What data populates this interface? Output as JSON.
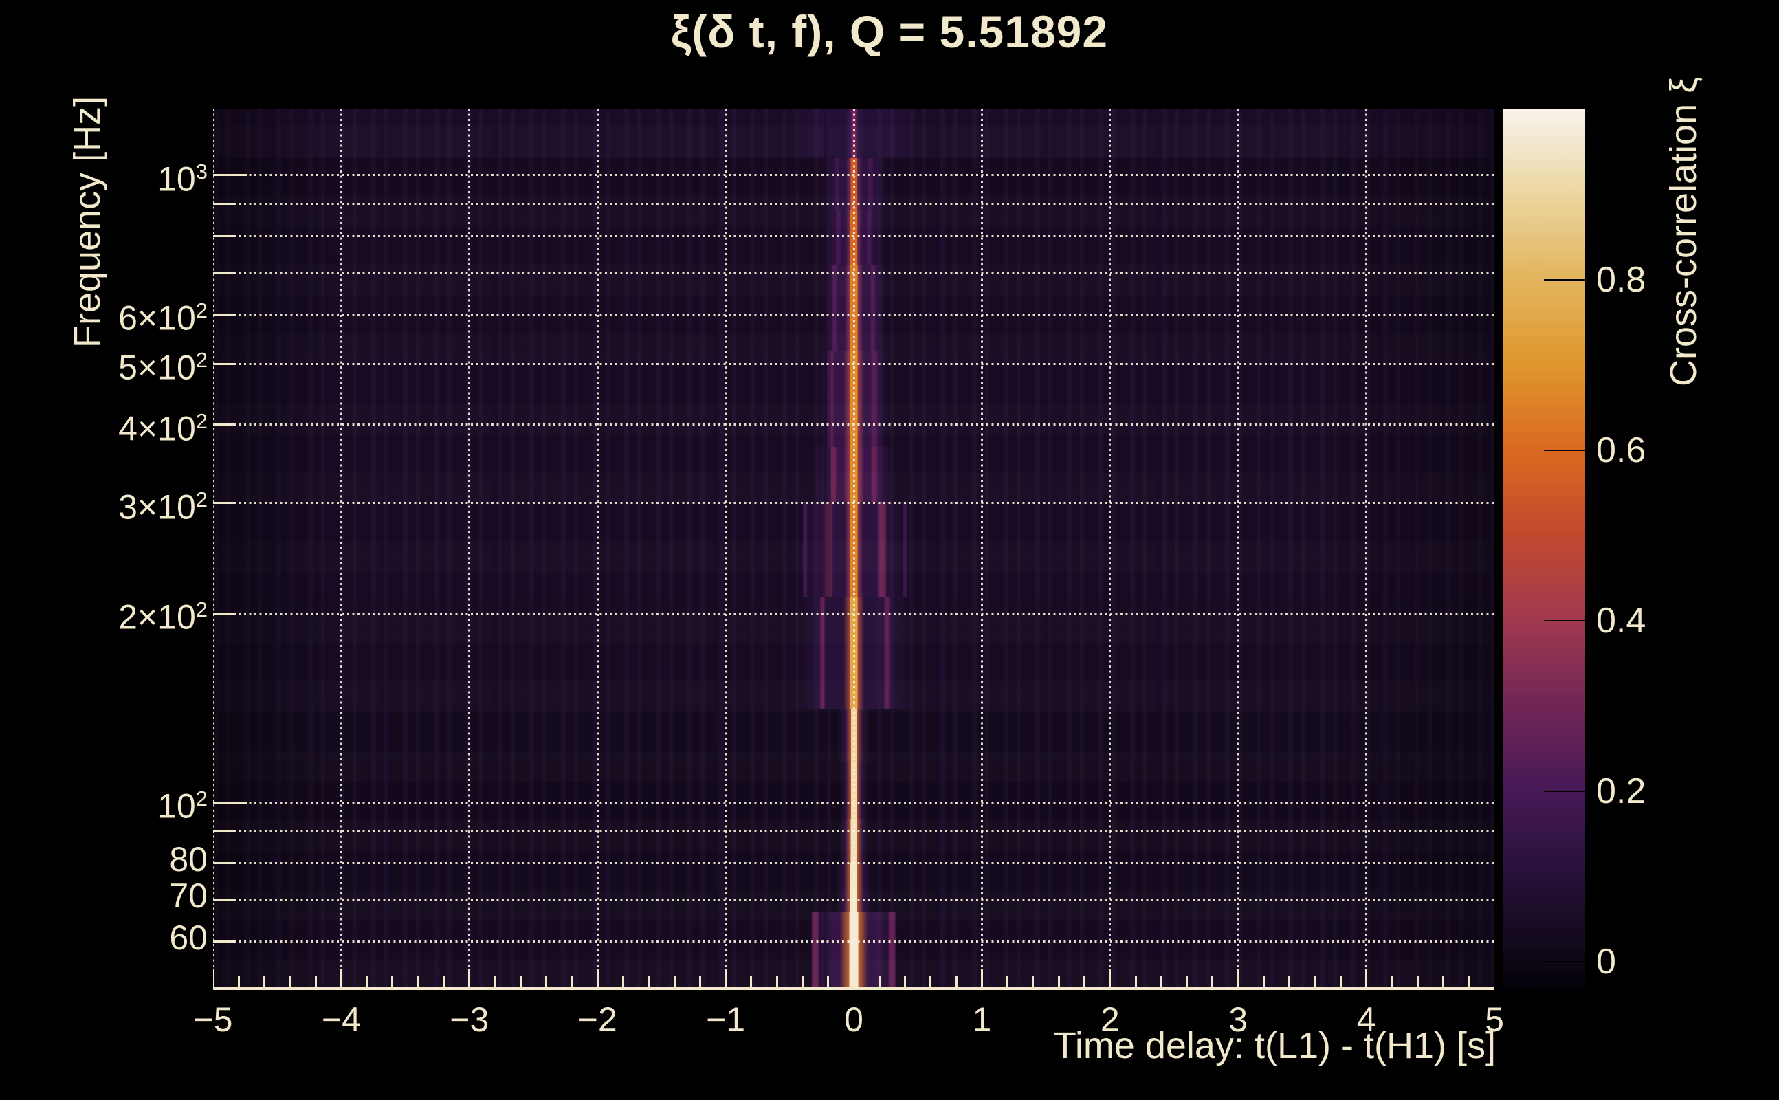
{
  "title": {
    "text": "ξ(δ t, f), Q = 5.51892"
  },
  "axes": {
    "x": {
      "title": "Time delay: t(L1) - t(H1) [s]",
      "ticks": [
        {
          "v": -5,
          "label": "−5"
        },
        {
          "v": -4,
          "label": "−4"
        },
        {
          "v": -3,
          "label": "−3"
        },
        {
          "v": -2,
          "label": "−2"
        },
        {
          "v": -1,
          "label": "−1"
        },
        {
          "v": 0,
          "label": "0"
        },
        {
          "v": 1,
          "label": "1"
        },
        {
          "v": 2,
          "label": "2"
        },
        {
          "v": 3,
          "label": "3"
        },
        {
          "v": 4,
          "label": "4"
        },
        {
          "v": 5,
          "label": "5"
        }
      ],
      "minor_step": 0.2
    },
    "y": {
      "title": "Frequency [Hz]",
      "ticks": [
        {
          "f": 1000,
          "mantissa": "10",
          "exp": "3"
        },
        {
          "f": 600,
          "mantissa": "6×10",
          "exp": "2"
        },
        {
          "f": 500,
          "mantissa": "5×10",
          "exp": "2"
        },
        {
          "f": 400,
          "mantissa": "4×10",
          "exp": "2"
        },
        {
          "f": 300,
          "mantissa": "3×10",
          "exp": "2"
        },
        {
          "f": 200,
          "mantissa": "2×10",
          "exp": "2"
        },
        {
          "f": 100,
          "mantissa": "10",
          "exp": "2"
        },
        {
          "f": 80,
          "mantissa": "80",
          "exp": null
        },
        {
          "f": 70,
          "mantissa": "70",
          "exp": null
        },
        {
          "f": 60,
          "mantissa": "60",
          "exp": null
        }
      ]
    },
    "colorbar": {
      "title": "Cross-correlation ξ",
      "ticks": [
        {
          "v": 0,
          "label": "0"
        },
        {
          "v": 0.2,
          "label": "0.2"
        },
        {
          "v": 0.4,
          "label": "0.4"
        },
        {
          "v": 0.6,
          "label": "0.6"
        },
        {
          "v": 0.8,
          "label": "0.8"
        }
      ]
    }
  },
  "chart_data": {
    "type": "heatmap",
    "title": "ξ(δ t, f), Q = 5.51892",
    "q_value": 5.51892,
    "xlabel": "Time delay: t(L1) - t(H1) [s]",
    "ylabel": "Frequency [Hz]",
    "zlabel": "Cross-correlation ξ",
    "x_range_s": [
      -5,
      5
    ],
    "y_range_hz": [
      50.2,
      1277
    ],
    "y_scale": "log",
    "z_range": [
      -0.033,
      1.001
    ],
    "grid": "dotted cream lines on",
    "grid_y_lines_hz": [
      60,
      70,
      80,
      90,
      100,
      200,
      300,
      400,
      500,
      600,
      700,
      800,
      900,
      1000
    ],
    "ridge_delta_t_s": 0,
    "background_xi": 0.03,
    "palette_stops": [
      [
        -0.033,
        "#030108"
      ],
      [
        0,
        "#0d0714"
      ],
      [
        0.1,
        "#261139"
      ],
      [
        0.2,
        "#471956"
      ],
      [
        0.3,
        "#702656"
      ],
      [
        0.4,
        "#a0384f"
      ],
      [
        0.5,
        "#c14a2e"
      ],
      [
        0.6,
        "#d96920"
      ],
      [
        0.7,
        "#e0962e"
      ],
      [
        0.8,
        "#e2b45c"
      ],
      [
        0.9,
        "#ecd5a0"
      ],
      [
        1,
        "#f7f3ec"
      ]
    ],
    "bands": [
      {
        "f_low": 50.2,
        "f_high": 67,
        "xi_bg": 0.03,
        "xi_peak": 0.97,
        "core_hw_s": 0.034,
        "glow": [
          0.11,
          0.62
        ],
        "shoulder": [
          0.34,
          0.16
        ],
        "satellites": [
          [
            -0.3,
            0.035,
            0.3
          ],
          [
            0.3,
            0.035,
            0.28
          ]
        ]
      },
      {
        "f_low": 67,
        "f_high": 80,
        "xi_bg": 0.025,
        "xi_peak": 0.96,
        "core_hw_s": 0.026,
        "glow": [
          0.075,
          0.6
        ],
        "shoulder": [
          0.14,
          0.14
        ],
        "satellites": []
      },
      {
        "f_low": 80,
        "f_high": 94,
        "xi_bg": 0.022,
        "xi_peak": 0.94,
        "core_hw_s": 0.023,
        "glow": [
          0.066,
          0.58
        ],
        "shoulder": [
          0.12,
          0.13
        ],
        "satellites": []
      },
      {
        "f_low": 94,
        "f_high": 116,
        "xi_bg": 0.022,
        "xi_peak": 0.92,
        "core_hw_s": 0.022,
        "glow": [
          0.06,
          0.56
        ],
        "shoulder": [
          0.11,
          0.12
        ],
        "satellites": []
      },
      {
        "f_low": 116,
        "f_high": 141,
        "xi_bg": 0.028,
        "xi_peak": 0.9,
        "core_hw_s": 0.022,
        "glow": [
          0.065,
          0.55
        ],
        "shoulder": [
          0.13,
          0.12
        ],
        "satellites": []
      },
      {
        "f_low": 141,
        "f_high": 212,
        "xi_bg": 0.035,
        "xi_peak": 0.76,
        "core_hw_s": 0.03,
        "glow": [
          0.08,
          0.5
        ],
        "shoulder": [
          0.46,
          0.11
        ],
        "satellites": [
          [
            -0.24,
            0.03,
            0.28
          ],
          [
            0.26,
            0.03,
            0.26
          ]
        ]
      },
      {
        "f_low": 212,
        "f_high": 301,
        "xi_bg": 0.04,
        "xi_peak": 0.66,
        "core_hw_s": 0.03,
        "glow": [
          0.07,
          0.43
        ],
        "shoulder": [
          0.42,
          0.13
        ],
        "satellites": [
          [
            -0.2,
            0.04,
            0.33
          ],
          [
            0.22,
            0.04,
            0.31
          ],
          [
            -0.38,
            0.022,
            0.19
          ],
          [
            0.4,
            0.022,
            0.17
          ]
        ]
      },
      {
        "f_low": 301,
        "f_high": 369,
        "xi_bg": 0.04,
        "xi_peak": 0.68,
        "core_hw_s": 0.03,
        "glow": [
          0.08,
          0.45
        ],
        "shoulder": [
          0.31,
          0.18
        ],
        "satellites": [
          [
            -0.16,
            0.03,
            0.3
          ],
          [
            0.16,
            0.03,
            0.29
          ]
        ]
      },
      {
        "f_low": 369,
        "f_high": 525,
        "xi_bg": 0.04,
        "xi_peak": 0.68,
        "core_hw_s": 0.03,
        "glow": [
          0.08,
          0.45
        ],
        "shoulder": [
          0.27,
          0.16
        ],
        "satellites": [
          [
            -0.18,
            0.03,
            0.25
          ],
          [
            0.16,
            0.03,
            0.24
          ]
        ]
      },
      {
        "f_low": 525,
        "f_high": 720,
        "xi_bg": 0.035,
        "xi_peak": 0.65,
        "core_hw_s": 0.03,
        "glow": [
          0.07,
          0.42
        ],
        "shoulder": [
          0.26,
          0.15
        ],
        "satellites": [
          [
            -0.15,
            0.025,
            0.22
          ],
          [
            0.15,
            0.025,
            0.22
          ]
        ]
      },
      {
        "f_low": 720,
        "f_high": 881,
        "xi_bg": 0.035,
        "xi_peak": 0.6,
        "core_hw_s": 0.026,
        "glow": [
          0.06,
          0.4
        ],
        "shoulder": [
          0.25,
          0.14
        ],
        "satellites": [
          [
            -0.12,
            0.022,
            0.2
          ],
          [
            0.12,
            0.022,
            0.2
          ]
        ]
      },
      {
        "f_low": 881,
        "f_high": 1065,
        "xi_bg": 0.03,
        "xi_peak": 0.55,
        "core_hw_s": 0.025,
        "glow": [
          0.06,
          0.35
        ],
        "shoulder": [
          0.27,
          0.13
        ],
        "satellites": [
          [
            -0.13,
            0.02,
            0.18
          ],
          [
            0.13,
            0.025,
            0.18
          ]
        ]
      },
      {
        "f_low": 1065,
        "f_high": 1277,
        "xi_bg": 0.05,
        "xi_peak": 0.3,
        "core_hw_s": 0.02,
        "glow": [
          0.05,
          0.2
        ],
        "shoulder": [
          0.5,
          0.1
        ],
        "satellites": []
      }
    ]
  }
}
